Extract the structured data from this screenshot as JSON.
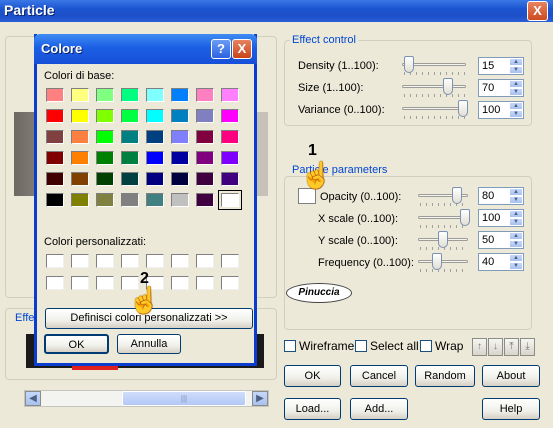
{
  "main_window": {
    "title": "Particle",
    "close_glyph": "X"
  },
  "effect_control": {
    "label": "Effect control",
    "rows": [
      {
        "label": "Density (1..100):",
        "value": "15",
        "level": 0.1
      },
      {
        "label": "Size (1..100):",
        "value": "70",
        "level": 0.68
      },
      {
        "label": "Variance (0..100):",
        "value": "100",
        "level": 1.0
      }
    ]
  },
  "particle_params": {
    "label": "Particle parameters",
    "rows": [
      {
        "label": "Opacity (0..100):",
        "value": "80",
        "level": 0.78
      },
      {
        "label": "X scale (0..100):",
        "value": "100",
        "level": 1.0
      },
      {
        "label": "Y scale (0..100):",
        "value": "50",
        "level": 0.5
      },
      {
        "label": "Frequency (0..100):",
        "value": "40",
        "level": 0.38
      }
    ]
  },
  "watermark": "Pinuccia",
  "preview_label": "Effe",
  "options": {
    "wireframe": "Wireframe",
    "select_all": "Select all",
    "wrap": "Wrap",
    "arrow_icons": [
      "arrow-up-icon",
      "arrow-down-icon",
      "arrow-top-icon",
      "arrow-bottom-icon"
    ]
  },
  "buttons": {
    "ok": "OK",
    "cancel": "Cancel",
    "random": "Random",
    "about": "About",
    "load": "Load...",
    "add": "Add...",
    "help": "Help"
  },
  "scrollbar_grip": "|||",
  "colore_dialog": {
    "title": "Colore",
    "help_glyph": "?",
    "close_glyph": "X",
    "basic_label": "Colori di base:",
    "custom_label": "Colori personalizzati:",
    "define_button": "Definisci colori personalizzati >>",
    "ok": "OK",
    "cancel": "Annulla",
    "basic_colors": [
      [
        "#ff8080",
        "#ffff80",
        "#80ff80",
        "#00ff80",
        "#80ffff",
        "#0080ff",
        "#ff80c0",
        "#ff80ff"
      ],
      [
        "#ff0000",
        "#ffff00",
        "#80ff00",
        "#00ff40",
        "#00ffff",
        "#0080c0",
        "#8080c0",
        "#ff00ff"
      ],
      [
        "#804040",
        "#ff8040",
        "#00ff00",
        "#008080",
        "#004080",
        "#8080ff",
        "#800040",
        "#ff0080"
      ],
      [
        "#800000",
        "#ff8000",
        "#008000",
        "#008040",
        "#0000ff",
        "#0000a0",
        "#800080",
        "#8000ff"
      ],
      [
        "#400000",
        "#804000",
        "#004000",
        "#004040",
        "#000080",
        "#000040",
        "#400040",
        "#400080"
      ],
      [
        "#000000",
        "#808000",
        "#808040",
        "#808080",
        "#408080",
        "#c0c0c0",
        "#400040",
        "#ffffff"
      ]
    ]
  },
  "annotations": {
    "marker_1": "1",
    "marker_2": "2"
  }
}
